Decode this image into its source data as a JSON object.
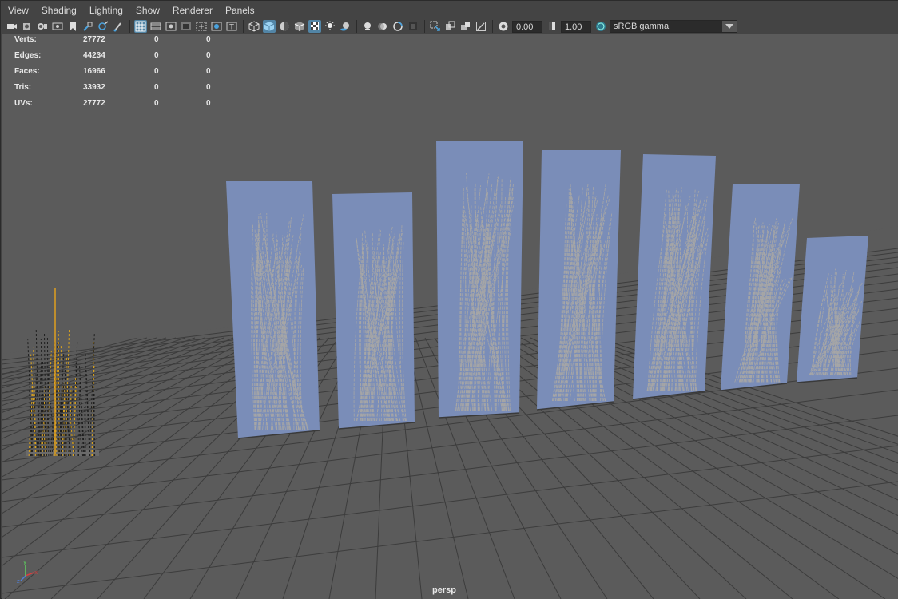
{
  "menu": [
    "View",
    "Shading",
    "Lighting",
    "Show",
    "Renderer",
    "Panels"
  ],
  "toolbar": {
    "exposure_value": "0.00",
    "gamma_value": "1.00",
    "color_space": "sRGB gamma",
    "colors": {
      "active": "#5285a6",
      "field_bg": "#2b2b2b"
    }
  },
  "hud": {
    "rows": [
      {
        "label": "Verts:",
        "v1": "27772",
        "v2": "0",
        "v3": "0"
      },
      {
        "label": "Edges:",
        "v1": "44234",
        "v2": "0",
        "v3": "0"
      },
      {
        "label": "Faces:",
        "v1": "16966",
        "v2": "0",
        "v3": "0"
      },
      {
        "label": "Tris:",
        "v1": "33932",
        "v2": "0",
        "v3": "0"
      },
      {
        "label": "UVs:",
        "v1": "27772",
        "v2": "0",
        "v3": "0"
      }
    ]
  },
  "viewport": {
    "camera": "persp",
    "axis": {
      "x_label": "x",
      "y_label": "y",
      "z_label": "z",
      "x_color": "#d64040",
      "y_color": "#5fd35f",
      "z_color": "#4f7fd8"
    },
    "card_color": "#7a8db8",
    "grid_color": "#3c3c3c"
  }
}
